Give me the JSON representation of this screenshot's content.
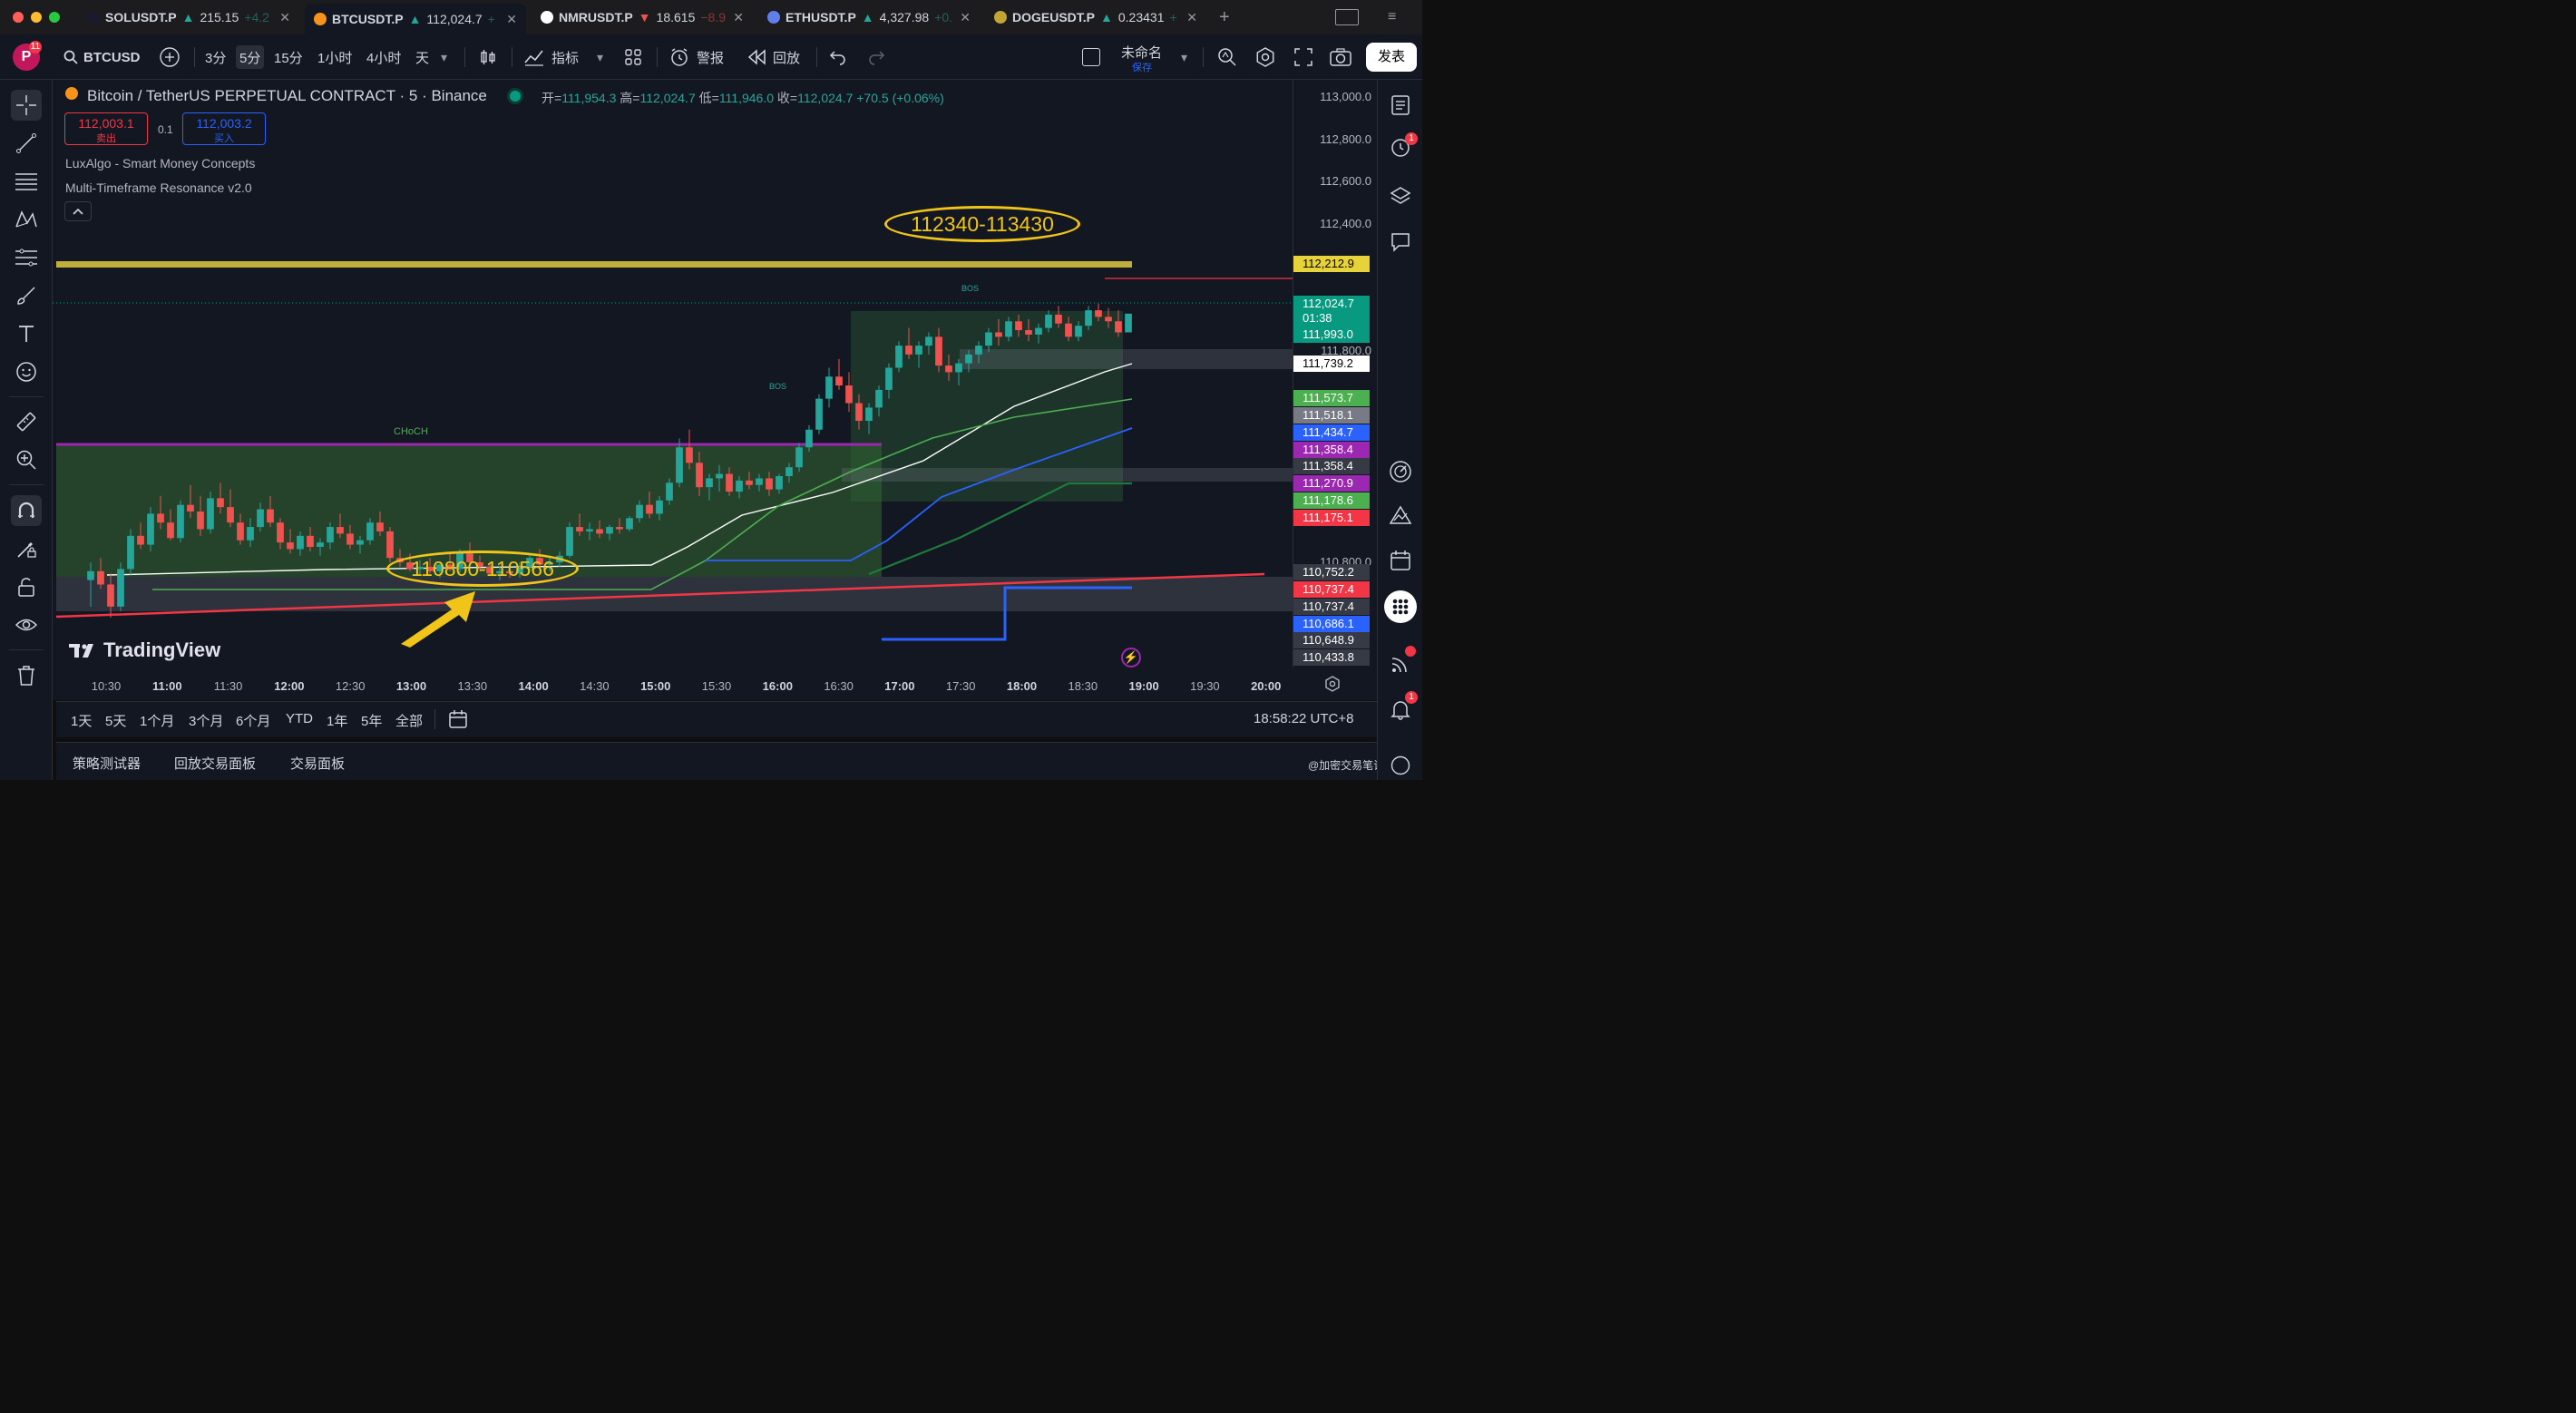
{
  "window": {
    "tabs": [
      {
        "symbol": "SOLUSDT.P",
        "price": "215.15",
        "change": "+4.2",
        "dir": "up",
        "coin_color": "#1a1a2e"
      },
      {
        "symbol": "BTCUSDT.P",
        "price": "112,024.7",
        "change": "+",
        "dir": "up",
        "coin_color": "#f7931a"
      },
      {
        "symbol": "NMRUSDT.P",
        "price": "18.615",
        "change": "−8.9",
        "dir": "down",
        "coin_color": "#ffffff"
      },
      {
        "symbol": "ETHUSDT.P",
        "price": "4,327.98",
        "change": "+0.",
        "dir": "up",
        "coin_color": "#627eea"
      },
      {
        "symbol": "DOGEUSDT.P",
        "price": "0.23431",
        "change": "+",
        "dir": "up",
        "coin_color": "#c2a633"
      }
    ],
    "new_tab": "+"
  },
  "toolbar": {
    "avatar_letter": "P",
    "avatar_badge": "11",
    "symbol": "BTCUSD",
    "intervals": [
      "3分",
      "5分",
      "15分",
      "1小时",
      "4小时",
      "天"
    ],
    "selected_interval": "5分",
    "indicators_label": "指标",
    "alerts_label": "警报",
    "replay_label": "回放",
    "layout_name": "未命名",
    "layout_saved": "保存",
    "publish_label": "发表"
  },
  "legend": {
    "title": "Bitcoin / TetherUS PERPETUAL CONTRACT · 5 · Binance",
    "open_label": "开=",
    "open": "111,954.3",
    "high_label": "高=",
    "high": "112,024.7",
    "low_label": "低=",
    "low": "111,946.0",
    "close_label": "收=",
    "close": "112,024.7",
    "change": "+70.5 (+0.06%)",
    "sell_price": "112,003.1",
    "sell_label": "卖出",
    "spread": "0.1",
    "buy_price": "112,003.2",
    "buy_label": "买入",
    "indicators": [
      "LuxAlgo - Smart Money Concepts",
      "Multi-Timeframe Resonance v2.0"
    ],
    "collapse_icon": "chevron-up-icon"
  },
  "annotations": {
    "upper_zone": "112340-113430",
    "lower_zone": "110800-110566",
    "choch_label": "CHoCH",
    "bos_label": "BOS",
    "watermark": "TradingView"
  },
  "price_scale": {
    "labels": [
      "113,000.0",
      "112,800.0",
      "112,600.0",
      "112,400.0",
      "111,800.0",
      "110,800.0"
    ],
    "tags": [
      {
        "value": "112,212.9",
        "bg": "#e8d23a",
        "fg": "#000000"
      },
      {
        "value": "112,024.7",
        "bg": "#089981",
        "fg": "#ffffff"
      },
      {
        "value": "01:38",
        "bg": "#089981",
        "fg": "#ffffff"
      },
      {
        "value": "111,993.0",
        "bg": "#089981",
        "fg": "#ffffff"
      },
      {
        "value": "111,739.2",
        "bg": "#ffffff",
        "fg": "#000000"
      },
      {
        "value": "111,573.7",
        "bg": "#4caf50",
        "fg": "#ffffff"
      },
      {
        "value": "111,518.1",
        "bg": "#787b86",
        "fg": "#ffffff"
      },
      {
        "value": "111,434.7",
        "bg": "#2962ff",
        "fg": "#ffffff"
      },
      {
        "value": "111,358.4",
        "bg": "#9c27b0",
        "fg": "#ffffff"
      },
      {
        "value": "111,358.4",
        "bg": "#363a45",
        "fg": "#ffffff"
      },
      {
        "value": "111,270.9",
        "bg": "#9c27b0",
        "fg": "#ffffff"
      },
      {
        "value": "111,178.6",
        "bg": "#4caf50",
        "fg": "#ffffff"
      },
      {
        "value": "111,175.1",
        "bg": "#f23645",
        "fg": "#ffffff"
      },
      {
        "value": "110,752.2",
        "bg": "#363a45",
        "fg": "#ffffff"
      },
      {
        "value": "110,737.4",
        "bg": "#f23645",
        "fg": "#ffffff"
      },
      {
        "value": "110,737.4",
        "bg": "#363a45",
        "fg": "#ffffff"
      },
      {
        "value": "110,686.1",
        "bg": "#2962ff",
        "fg": "#ffffff"
      },
      {
        "value": "110,648.9",
        "bg": "#363a45",
        "fg": "#ffffff"
      },
      {
        "value": "110,433.8",
        "bg": "#363a45",
        "fg": "#ffffff"
      }
    ]
  },
  "time_axis": [
    {
      "label": "10:30",
      "bold": false
    },
    {
      "label": "11:00",
      "bold": true
    },
    {
      "label": "11:30",
      "bold": false
    },
    {
      "label": "12:00",
      "bold": true
    },
    {
      "label": "12:30",
      "bold": false
    },
    {
      "label": "13:00",
      "bold": true
    },
    {
      "label": "13:30",
      "bold": false
    },
    {
      "label": "14:00",
      "bold": true
    },
    {
      "label": "14:30",
      "bold": false
    },
    {
      "label": "15:00",
      "bold": true
    },
    {
      "label": "15:30",
      "bold": false
    },
    {
      "label": "16:00",
      "bold": true
    },
    {
      "label": "16:30",
      "bold": false
    },
    {
      "label": "17:00",
      "bold": true
    },
    {
      "label": "17:30",
      "bold": false
    },
    {
      "label": "18:00",
      "bold": true
    },
    {
      "label": "18:30",
      "bold": false
    },
    {
      "label": "19:00",
      "bold": true
    },
    {
      "label": "19:30",
      "bold": false
    },
    {
      "label": "20:00",
      "bold": true
    }
  ],
  "range_bar": {
    "ranges": [
      "1天",
      "5天",
      "1个月",
      "3个月",
      "6个月",
      "YTD",
      "1年",
      "5年",
      "全部"
    ],
    "clock": "18:58:22 UTC+8"
  },
  "bottom_panel": {
    "tabs": [
      "策略测试器",
      "回放交易面板",
      "交易面板"
    ],
    "footer_note": "@加密交易笔记"
  },
  "right_badges": {
    "alerts_clock": "1",
    "notifications": "1"
  },
  "colors": {
    "up": "#26a69a",
    "down": "#ef5350",
    "accent": "#2962ff",
    "zone_green": "#4caf50",
    "annotation_yellow": "#f0c419"
  },
  "chart_data": {
    "type": "candlestick",
    "symbol": "BTCUSDT.P",
    "interval": "5",
    "ylim": [
      110400,
      113000
    ],
    "x_start": "10:15",
    "x_end": "20:00",
    "candles": [
      [
        110820,
        110900,
        110700,
        110860
      ],
      [
        110860,
        110920,
        110780,
        110800
      ],
      [
        110800,
        110850,
        110650,
        110700
      ],
      [
        110700,
        110900,
        110680,
        110870
      ],
      [
        110870,
        111050,
        110840,
        111020
      ],
      [
        111020,
        111080,
        110960,
        110980
      ],
      [
        110980,
        111150,
        110950,
        111120
      ],
      [
        111120,
        111200,
        111050,
        111080
      ],
      [
        111080,
        111140,
        111000,
        111010
      ],
      [
        111010,
        111180,
        110990,
        111160
      ],
      [
        111160,
        111250,
        111100,
        111130
      ],
      [
        111130,
        111200,
        111020,
        111050
      ],
      [
        111050,
        111220,
        111030,
        111190
      ],
      [
        111190,
        111260,
        111120,
        111150
      ],
      [
        111150,
        111230,
        111060,
        111080
      ],
      [
        111080,
        111120,
        110980,
        111000
      ],
      [
        111000,
        111100,
        110970,
        111060
      ],
      [
        111060,
        111170,
        111040,
        111140
      ],
      [
        111140,
        111200,
        111060,
        111080
      ],
      [
        111080,
        111100,
        110960,
        110990
      ],
      [
        110990,
        111050,
        110940,
        110960
      ],
      [
        110960,
        111040,
        110930,
        111020
      ],
      [
        111020,
        111060,
        110950,
        110970
      ],
      [
        110970,
        111010,
        110930,
        110990
      ],
      [
        110990,
        111080,
        110960,
        111060
      ],
      [
        111060,
        111120,
        111010,
        111030
      ],
      [
        111030,
        111070,
        110960,
        110980
      ],
      [
        110980,
        111020,
        110940,
        111000
      ],
      [
        111000,
        111100,
        110980,
        111080
      ],
      [
        111080,
        111130,
        111020,
        111040
      ],
      [
        111040,
        111060,
        110900,
        110920
      ],
      [
        110920,
        110960,
        110880,
        110900
      ],
      [
        110900,
        110940,
        110860,
        110870
      ],
      [
        110870,
        110910,
        110840,
        110880
      ],
      [
        110880,
        110920,
        110850,
        110860
      ],
      [
        110860,
        110900,
        110830,
        110890
      ],
      [
        110890,
        110940,
        110860,
        110870
      ],
      [
        110870,
        110960,
        110850,
        110940
      ],
      [
        110940,
        110990,
        110880,
        110900
      ],
      [
        110900,
        110930,
        110860,
        110880
      ],
      [
        110880,
        110900,
        110840,
        110850
      ],
      [
        110850,
        110880,
        110820,
        110860
      ],
      [
        110860,
        110890,
        110830,
        110850
      ],
      [
        110850,
        110900,
        110830,
        110880
      ],
      [
        110880,
        110940,
        110860,
        110920
      ],
      [
        110920,
        110960,
        110880,
        110890
      ],
      [
        110890,
        110930,
        110860,
        110900
      ],
      [
        110900,
        110950,
        110880,
        110930
      ],
      [
        110930,
        111080,
        110920,
        111060
      ],
      [
        111060,
        111120,
        111020,
        111040
      ],
      [
        111040,
        111080,
        111000,
        111050
      ],
      [
        111050,
        111090,
        111010,
        111030
      ],
      [
        111030,
        111070,
        111000,
        111060
      ],
      [
        111060,
        111100,
        111030,
        111050
      ],
      [
        111050,
        111110,
        111040,
        111100
      ],
      [
        111100,
        111180,
        111080,
        111160
      ],
      [
        111160,
        111220,
        111100,
        111120
      ],
      [
        111120,
        111200,
        111090,
        111180
      ],
      [
        111180,
        111280,
        111160,
        111260
      ],
      [
        111260,
        111460,
        111240,
        111420
      ],
      [
        111420,
        111500,
        111320,
        111350
      ],
      [
        111350,
        111400,
        111200,
        111240
      ],
      [
        111240,
        111300,
        111180,
        111280
      ],
      [
        111280,
        111340,
        111220,
        111300
      ],
      [
        111300,
        111330,
        111200,
        111220
      ],
      [
        111220,
        111290,
        111190,
        111270
      ],
      [
        111270,
        111310,
        111230,
        111250
      ],
      [
        111250,
        111300,
        111220,
        111280
      ],
      [
        111280,
        111310,
        111200,
        111230
      ],
      [
        111230,
        111300,
        111210,
        111290
      ],
      [
        111290,
        111350,
        111260,
        111330
      ],
      [
        111330,
        111440,
        111310,
        111420
      ],
      [
        111420,
        111520,
        111400,
        111500
      ],
      [
        111500,
        111660,
        111480,
        111640
      ],
      [
        111640,
        111780,
        111600,
        111740
      ],
      [
        111740,
        111820,
        111680,
        111700
      ],
      [
        111700,
        111760,
        111580,
        111620
      ],
      [
        111620,
        111660,
        111500,
        111540
      ],
      [
        111540,
        111620,
        111480,
        111600
      ],
      [
        111600,
        111700,
        111560,
        111680
      ],
      [
        111680,
        111800,
        111640,
        111780
      ],
      [
        111780,
        111900,
        111760,
        111880
      ],
      [
        111880,
        111960,
        111820,
        111840
      ],
      [
        111840,
        111900,
        111780,
        111880
      ],
      [
        111880,
        111940,
        111840,
        111920
      ],
      [
        111920,
        111960,
        111760,
        111790
      ],
      [
        111790,
        111840,
        111720,
        111760
      ],
      [
        111760,
        111820,
        111700,
        111800
      ],
      [
        111800,
        111860,
        111760,
        111840
      ],
      [
        111840,
        111900,
        111800,
        111880
      ],
      [
        111880,
        111960,
        111850,
        111940
      ],
      [
        111940,
        112000,
        111880,
        111920
      ],
      [
        111920,
        112010,
        111900,
        111990
      ],
      [
        111990,
        112020,
        111920,
        111950
      ],
      [
        111950,
        112000,
        111900,
        111930
      ],
      [
        111930,
        111980,
        111890,
        111960
      ],
      [
        111960,
        112040,
        111940,
        112020
      ],
      [
        112020,
        112060,
        111960,
        111980
      ],
      [
        111980,
        112010,
        111900,
        111920
      ],
      [
        111920,
        111990,
        111900,
        111970
      ],
      [
        111970,
        112060,
        111950,
        112040
      ],
      [
        112040,
        112070,
        111990,
        112010
      ],
      [
        112010,
        112050,
        111960,
        111990
      ],
      [
        111990,
        112040,
        111920,
        111940
      ],
      [
        111940,
        112024.7,
        111946,
        112024.7
      ]
    ]
  }
}
